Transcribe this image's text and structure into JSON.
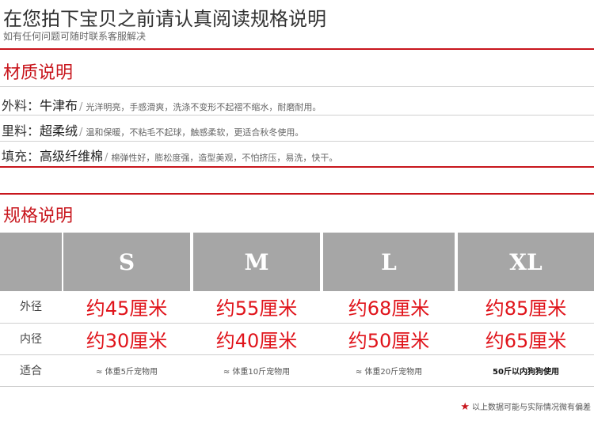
{
  "header": {
    "title": "在您拍下宝贝之前请认真阅读规格说明",
    "subtitle": "如有任何问题可随时联系客服解决"
  },
  "material": {
    "section_title": "材质说明",
    "rows": [
      {
        "label": "外料：",
        "main": "牛津布",
        "desc": "光洋明亮，手感滑爽，洗涤不变形不起褶不缩水，耐磨耐用。"
      },
      {
        "label": "里料：",
        "main": "超柔绒",
        "desc": "温和保暖，不粘毛不起球，触感柔软，更适合秋冬使用。"
      },
      {
        "label": "填充：",
        "main": "高级纤维棉",
        "desc": "棉弹性好，膨松度强，造型美观，不怕挤压，易洗，快干。"
      }
    ]
  },
  "spec": {
    "section_title": "规格说明",
    "sizes": [
      "S",
      "M",
      "L",
      "XL"
    ],
    "rows": [
      {
        "label": "外径",
        "values": [
          "约45厘米",
          "约55厘米",
          "约68厘米",
          "约85厘米"
        ]
      },
      {
        "label": "内径",
        "values": [
          "约30厘米",
          "约40厘米",
          "约50厘米",
          "约65厘米"
        ]
      },
      {
        "label": "适合",
        "values": [
          "≈ 体重5斤宠物用",
          "≈ 体重10斤宠物用",
          "≈ 体重20斤宠物用",
          "50斤以内狗狗使用"
        ]
      }
    ],
    "note": "以上数据可能与实际情况微有偏差"
  },
  "colors": {
    "accent_red": "#c8161d",
    "value_red": "#e0141b",
    "header_gray": "#a6a6a6"
  }
}
